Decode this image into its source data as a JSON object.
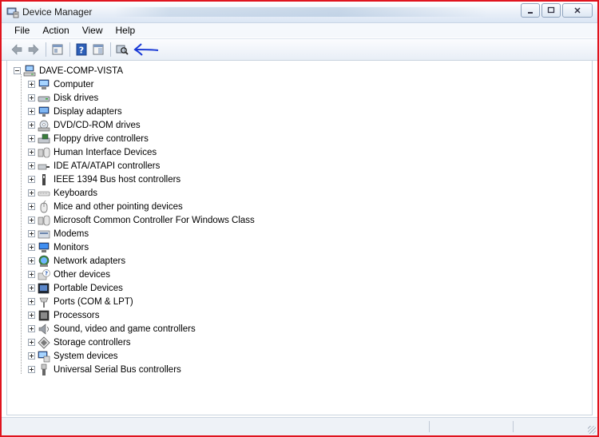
{
  "window": {
    "title": "Device Manager"
  },
  "menu": {
    "items": [
      "File",
      "Action",
      "View",
      "Help"
    ]
  },
  "toolbar": {
    "buttons": [
      "back-icon",
      "forward-icon",
      "properties-icon",
      "help-icon",
      "show-hide-console-tree-icon",
      "scan-hardware-icon"
    ]
  },
  "tree": {
    "root": "DAVE-COMP-VISTA",
    "items": [
      {
        "label": "Computer",
        "icon": "computer-icon"
      },
      {
        "label": "Disk drives",
        "icon": "disk-drive-icon"
      },
      {
        "label": "Display adapters",
        "icon": "display-adapter-icon"
      },
      {
        "label": "DVD/CD-ROM drives",
        "icon": "dvd-drive-icon"
      },
      {
        "label": "Floppy drive controllers",
        "icon": "floppy-controller-icon"
      },
      {
        "label": "Human Interface Devices",
        "icon": "hid-icon"
      },
      {
        "label": "IDE ATA/ATAPI controllers",
        "icon": "ide-controller-icon"
      },
      {
        "label": "IEEE 1394 Bus host controllers",
        "icon": "ieee1394-icon"
      },
      {
        "label": "Keyboards",
        "icon": "keyboard-icon"
      },
      {
        "label": "Mice and other pointing devices",
        "icon": "mouse-icon"
      },
      {
        "label": "Microsoft Common Controller For Windows Class",
        "icon": "controller-icon"
      },
      {
        "label": "Modems",
        "icon": "modem-icon"
      },
      {
        "label": "Monitors",
        "icon": "monitor-icon"
      },
      {
        "label": "Network adapters",
        "icon": "network-adapter-icon"
      },
      {
        "label": "Other devices",
        "icon": "other-devices-icon"
      },
      {
        "label": "Portable Devices",
        "icon": "portable-device-icon"
      },
      {
        "label": "Ports (COM & LPT)",
        "icon": "port-icon"
      },
      {
        "label": "Processors",
        "icon": "processor-icon"
      },
      {
        "label": "Sound, video and game controllers",
        "icon": "sound-icon"
      },
      {
        "label": "Storage controllers",
        "icon": "storage-controller-icon"
      },
      {
        "label": "System devices",
        "icon": "system-devices-icon"
      },
      {
        "label": "Universal Serial Bus controllers",
        "icon": "usb-icon"
      }
    ]
  },
  "colors": {
    "window_border": "#e0141e",
    "annotation_arrow": "#1a3ad6"
  }
}
